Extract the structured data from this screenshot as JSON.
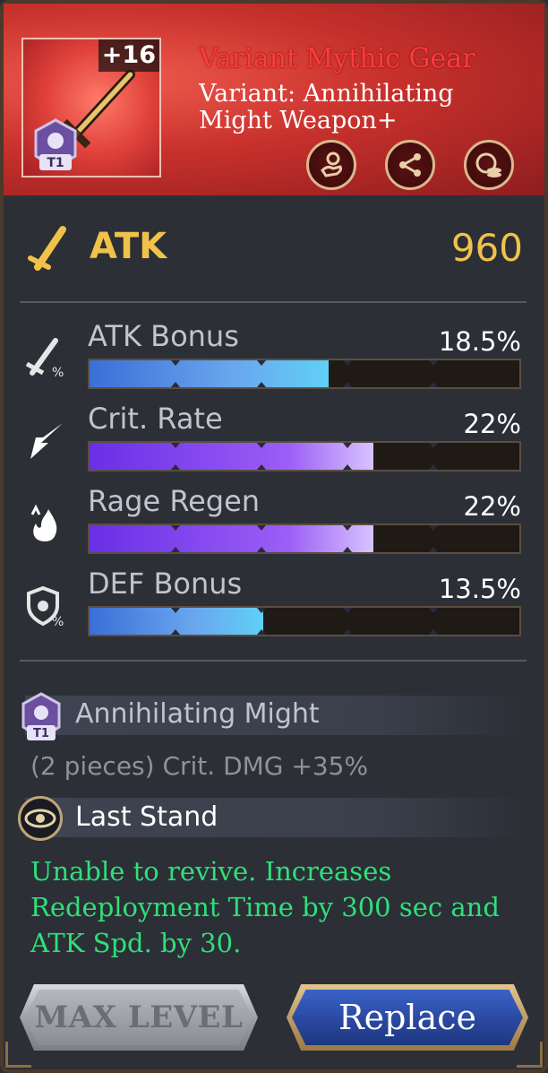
{
  "item": {
    "enhance_level": "+16",
    "tier": "T1",
    "rarity_title": "Variant Mythic Gear",
    "name": "Variant: Annihilating Might Weapon+",
    "colors": {
      "title": "#ff3b3b",
      "header_bg": "#c8312c"
    }
  },
  "header_actions": [
    {
      "icon": "hand-coin-icon"
    },
    {
      "icon": "share-icon"
    },
    {
      "icon": "coins-icon"
    }
  ],
  "main_stat": {
    "label": "ATK",
    "value": "960",
    "color": "#f1c24a"
  },
  "sub_stats": [
    {
      "label": "ATK Bonus",
      "value": "18.5%",
      "fill_fraction": 0.557,
      "color": "blue"
    },
    {
      "label": "Crit. Rate",
      "value": "22%",
      "fill_fraction": 0.66,
      "color": "purple"
    },
    {
      "label": "Rage Regen",
      "value": "22%",
      "fill_fraction": 0.66,
      "color": "purple"
    },
    {
      "label": "DEF Bonus",
      "value": "13.5%",
      "fill_fraction": 0.405,
      "color": "blue"
    }
  ],
  "set_bonus": {
    "tier": "T1",
    "name": "Annihilating Might",
    "description": "(2 pieces) Crit. DMG +35%"
  },
  "skill": {
    "name": "Last Stand",
    "description": "Unable to revive. Increases Redeployment Time by 300 sec and ATK Spd. by 30.",
    "color": "#2ee07a"
  },
  "buttons": {
    "max_level": "MAX LEVEL",
    "replace": "Replace"
  }
}
